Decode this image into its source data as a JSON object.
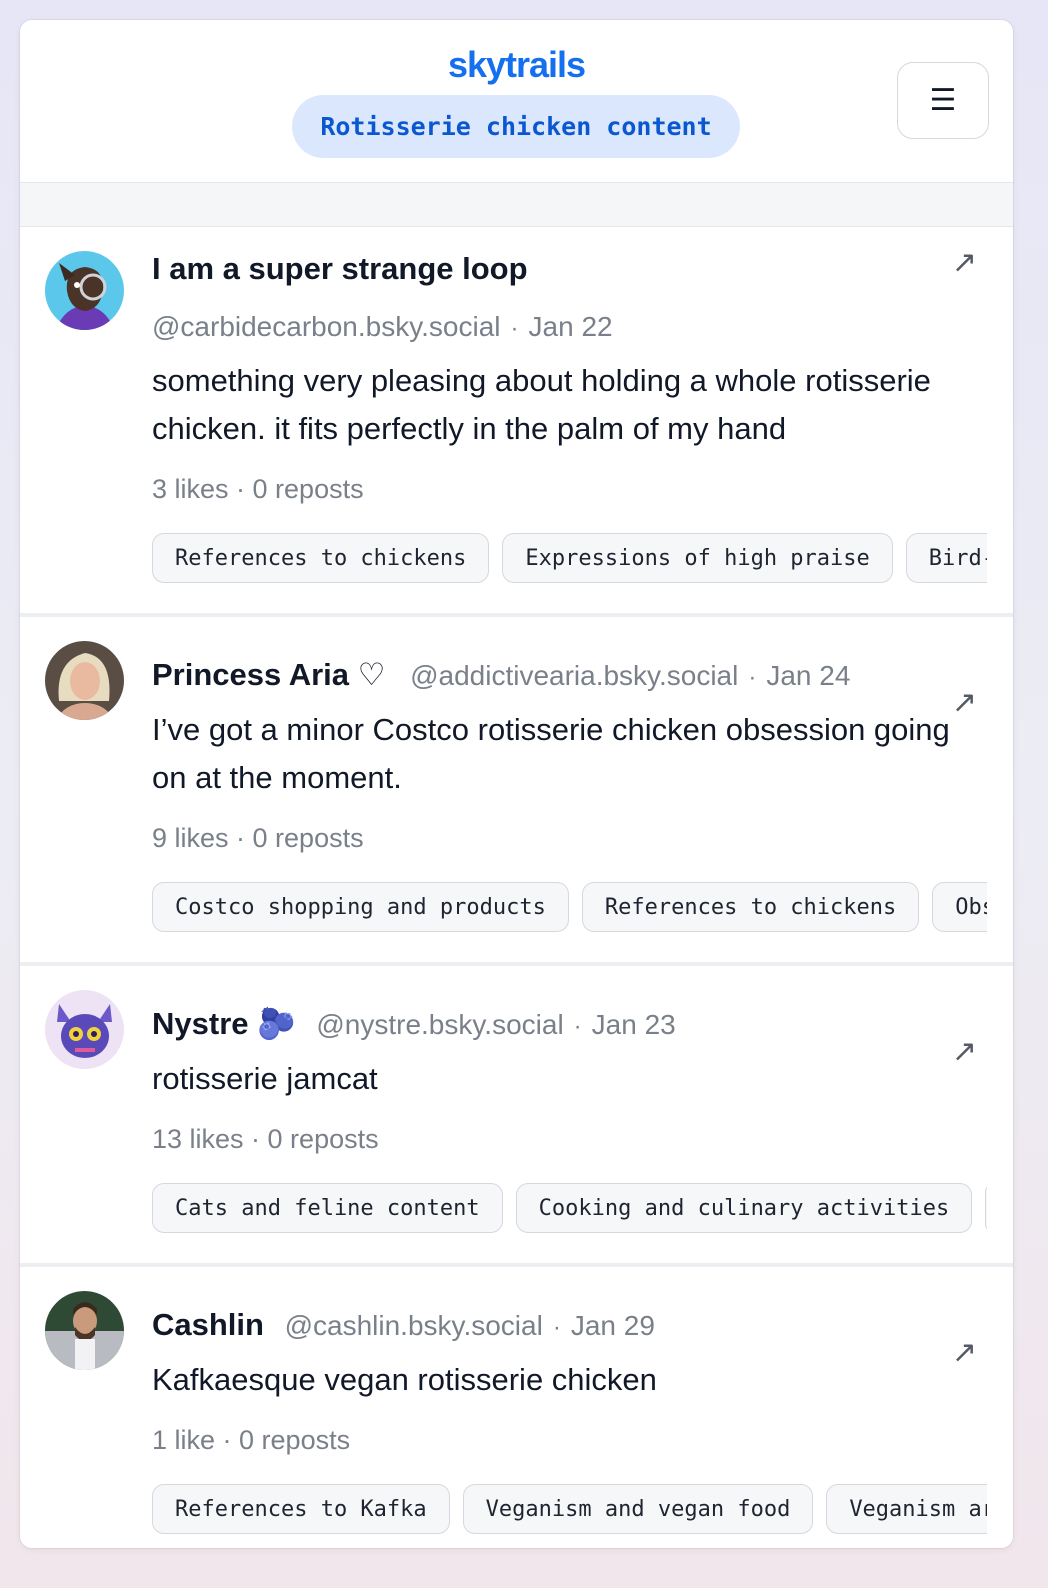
{
  "brand": "skytrails",
  "feed_title": "Rotisserie chicken content",
  "menu_icon": "hamburger-menu-icon",
  "external_link_icon": "arrow-up-right-icon",
  "posts": [
    {
      "display_name": "I am a super strange loop",
      "badge": "",
      "handle": "@carbidecarbon.bsky.social",
      "date": "Jan 22",
      "text": "something very pleasing about holding a whole rotisserie chicken. it fits perfectly in the palm of my hand",
      "stats": "3 likes · 0 reposts",
      "tags": [
        "References to chickens",
        "Expressions of high praise",
        "Bird-"
      ]
    },
    {
      "display_name": "Princess Aria",
      "badge": "♡",
      "handle": "@addictivearia.bsky.social",
      "date": "Jan 24",
      "text": "I’ve got a minor Costco rotisserie chicken obsession going on at the moment.",
      "stats": "9 likes · 0 reposts",
      "tags": [
        "Costco shopping and products",
        "References to chickens",
        "Obs"
      ]
    },
    {
      "display_name": "Nystre",
      "badge": "🫐",
      "handle": "@nystre.bsky.social",
      "date": "Jan 23",
      "text": "rotisserie jamcat",
      "stats": "13 likes · 0 reposts",
      "tags": [
        "Cats and feline content",
        "Cooking and culinary activities"
      ]
    },
    {
      "display_name": "Cashlin",
      "badge": "",
      "handle": "@cashlin.bsky.social",
      "date": "Jan 29",
      "text": "Kafkaesque vegan rotisserie chicken",
      "stats": "1 like · 0 reposts",
      "tags": [
        "References to Kafka",
        "Veganism and vegan food",
        "Veganism ar"
      ]
    }
  ]
}
